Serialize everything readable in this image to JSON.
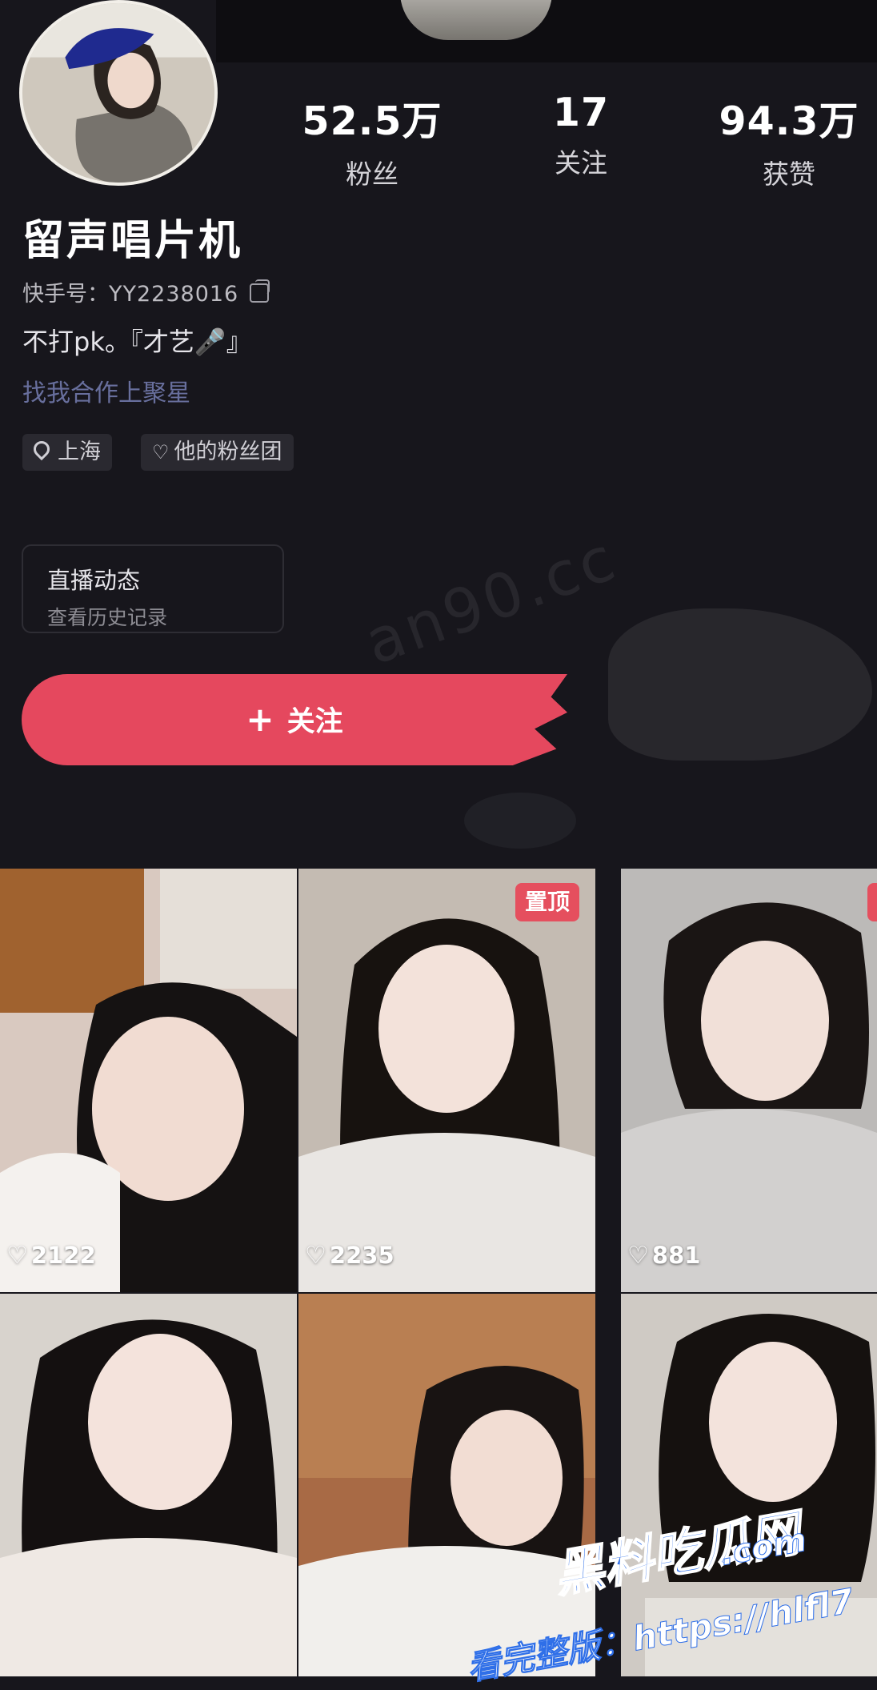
{
  "profile": {
    "name": "留声唱片机",
    "kuaishou_id_label": "快手号：",
    "kuaishou_id": "YY2238016",
    "bio": "不打pk。『才艺🎤』",
    "collab_link": "找我合作上聚星",
    "tags": {
      "location": "上海",
      "fan_group": "他的粉丝团"
    }
  },
  "stats": {
    "fans": {
      "value": "52.5万",
      "label": "粉丝"
    },
    "following": {
      "value": "17",
      "label": "关注"
    },
    "likes": {
      "value": "94.3万",
      "label": "获赞"
    }
  },
  "live_card": {
    "title": "直播动态",
    "subtitle": "查看历史记录"
  },
  "follow_button": {
    "label": "关注",
    "icon": "plus-icon"
  },
  "watermark": "an90.cc",
  "videos": [
    {
      "likes": "2122",
      "pinned": false
    },
    {
      "likes": "2235",
      "pinned": true,
      "pin_label": "置顶"
    },
    {
      "likes": "881",
      "pinned": true,
      "pin_label": "置"
    },
    {
      "pinned": false
    },
    {
      "pinned": false
    },
    {
      "pinned": false
    }
  ],
  "site_watermark": {
    "name": "黑料吃瓜网",
    "url": ".com",
    "full_version": "看完整版：https://hlfl7"
  },
  "colors": {
    "background": "#17161c",
    "accent": "#e5485e",
    "link": "#686f9d"
  }
}
